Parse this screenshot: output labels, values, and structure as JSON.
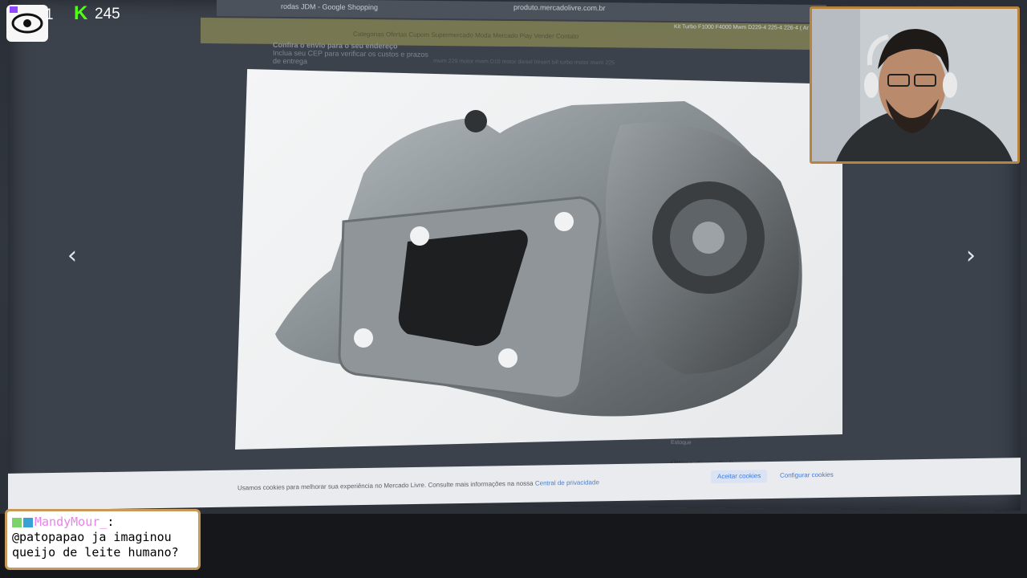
{
  "browser": {
    "tab_title": "rodas JDM - Google Shopping",
    "url": "produto.mercadolivre.com.br"
  },
  "page": {
    "categories": "Categorias   Ofertas   Cupom   Supermercado   Moda   Mercado Play   Vender   Contato",
    "shipping_title": "Confira o envio para o seu endereço",
    "shipping_text": "Inclua seu CEP para verificar os custos e prazos de entrega",
    "product_tags": "mwm 229   motor mwm D10   motor diesel tresert bill turbo   motor mwm 225",
    "product_title": "Kit Turbo F1000 F4000 Mwm D229-4 225-4 226-4 ( Ar",
    "availability": "Último disponível!",
    "stock_label": "Estoque"
  },
  "nav": {
    "prev_label": "‹",
    "next_label": "›"
  },
  "cookie": {
    "text": "Usamos cookies para melhorar sua experiência no Mercado Livre. Consulte mais informações na nossa ",
    "link": "Central de privacidade",
    "accept_label": "Aceitar cookies",
    "config_label": "Configurar cookies"
  },
  "stream": {
    "twitch_viewers": "1",
    "kick_viewers": "245"
  },
  "chat": {
    "username": "MandyMour_",
    "separator": ":",
    "message": "@patopapao ja imaginou queijo de leite humano?"
  },
  "colors": {
    "kick_green": "#53fc18",
    "chat_user": "#e883e8",
    "webcam_border": "#b8823f"
  }
}
